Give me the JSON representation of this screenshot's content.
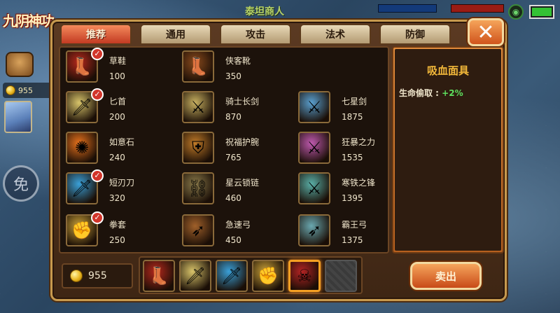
{
  "hud": {
    "logo_text": "九阴神功",
    "gold": "955",
    "skill_label": "免",
    "shop_title": "泰坦商人"
  },
  "tabs": [
    {
      "label": "推荐",
      "active": true
    },
    {
      "label": "通用",
      "active": false
    },
    {
      "label": "攻击",
      "active": false
    },
    {
      "label": "法术",
      "active": false
    },
    {
      "label": "防御",
      "active": false
    }
  ],
  "close_icon": "✕",
  "items": [
    {
      "name": "草鞋",
      "price": "100",
      "owned": true,
      "icon": "boots-icon",
      "color": "#b5281c"
    },
    {
      "name": "侠客靴",
      "price": "350",
      "owned": false,
      "icon": "boots-icon",
      "color": "#8a4a1c"
    },
    {
      "name": "匕首",
      "price": "200",
      "owned": true,
      "icon": "dagger-icon",
      "color": "#d8c46a"
    },
    {
      "name": "骑士长剑",
      "price": "870",
      "owned": false,
      "icon": "sword-icon",
      "color": "#c8b060"
    },
    {
      "name": "七星剑",
      "price": "1875",
      "owned": false,
      "icon": "sword-icon",
      "color": "#5aa0d0"
    },
    {
      "name": "如意石",
      "price": "240",
      "owned": false,
      "icon": "stone-icon",
      "color": "#e8721c"
    },
    {
      "name": "祝福护腕",
      "price": "765",
      "owned": false,
      "icon": "bracer-icon",
      "color": "#c07a28"
    },
    {
      "name": "狂暴之力",
      "price": "1535",
      "owned": false,
      "icon": "sword-icon",
      "color": "#c05ab0"
    },
    {
      "name": "短刃刀",
      "price": "320",
      "owned": true,
      "icon": "blade-icon",
      "color": "#3aa0d8"
    },
    {
      "name": "星云锁链",
      "price": "460",
      "owned": false,
      "icon": "chain-icon",
      "color": "#8a7a4a"
    },
    {
      "name": "寒铁之锋",
      "price": "1395",
      "owned": false,
      "icon": "sword-icon",
      "color": "#5ab0a8"
    },
    {
      "name": "拳套",
      "price": "250",
      "owned": true,
      "icon": "gauntlet-icon",
      "color": "#c8a038"
    },
    {
      "name": "急速弓",
      "price": "450",
      "owned": false,
      "icon": "bow-icon",
      "color": "#a0602a"
    },
    {
      "name": "霸王弓",
      "price": "1375",
      "owned": false,
      "icon": "bow-icon",
      "color": "#6aa8b0"
    }
  ],
  "detail": {
    "name": "吸血面具",
    "stat_label": "生命偷取 :",
    "stat_value": "+2%"
  },
  "bottom": {
    "gold": "955",
    "sell_label": "卖出"
  },
  "inventory": [
    {
      "icon": "boots-icon",
      "color": "#b5281c",
      "selected": false
    },
    {
      "icon": "dagger-icon",
      "color": "#d8c46a",
      "selected": false
    },
    {
      "icon": "blade-icon",
      "color": "#3aa0d8",
      "selected": false
    },
    {
      "icon": "gauntlet-icon",
      "color": "#c8a038",
      "selected": false
    },
    {
      "icon": "mask-icon",
      "color": "#b52424",
      "selected": true
    },
    {
      "icon": "empty",
      "color": "#3a3a3a",
      "selected": false
    }
  ]
}
